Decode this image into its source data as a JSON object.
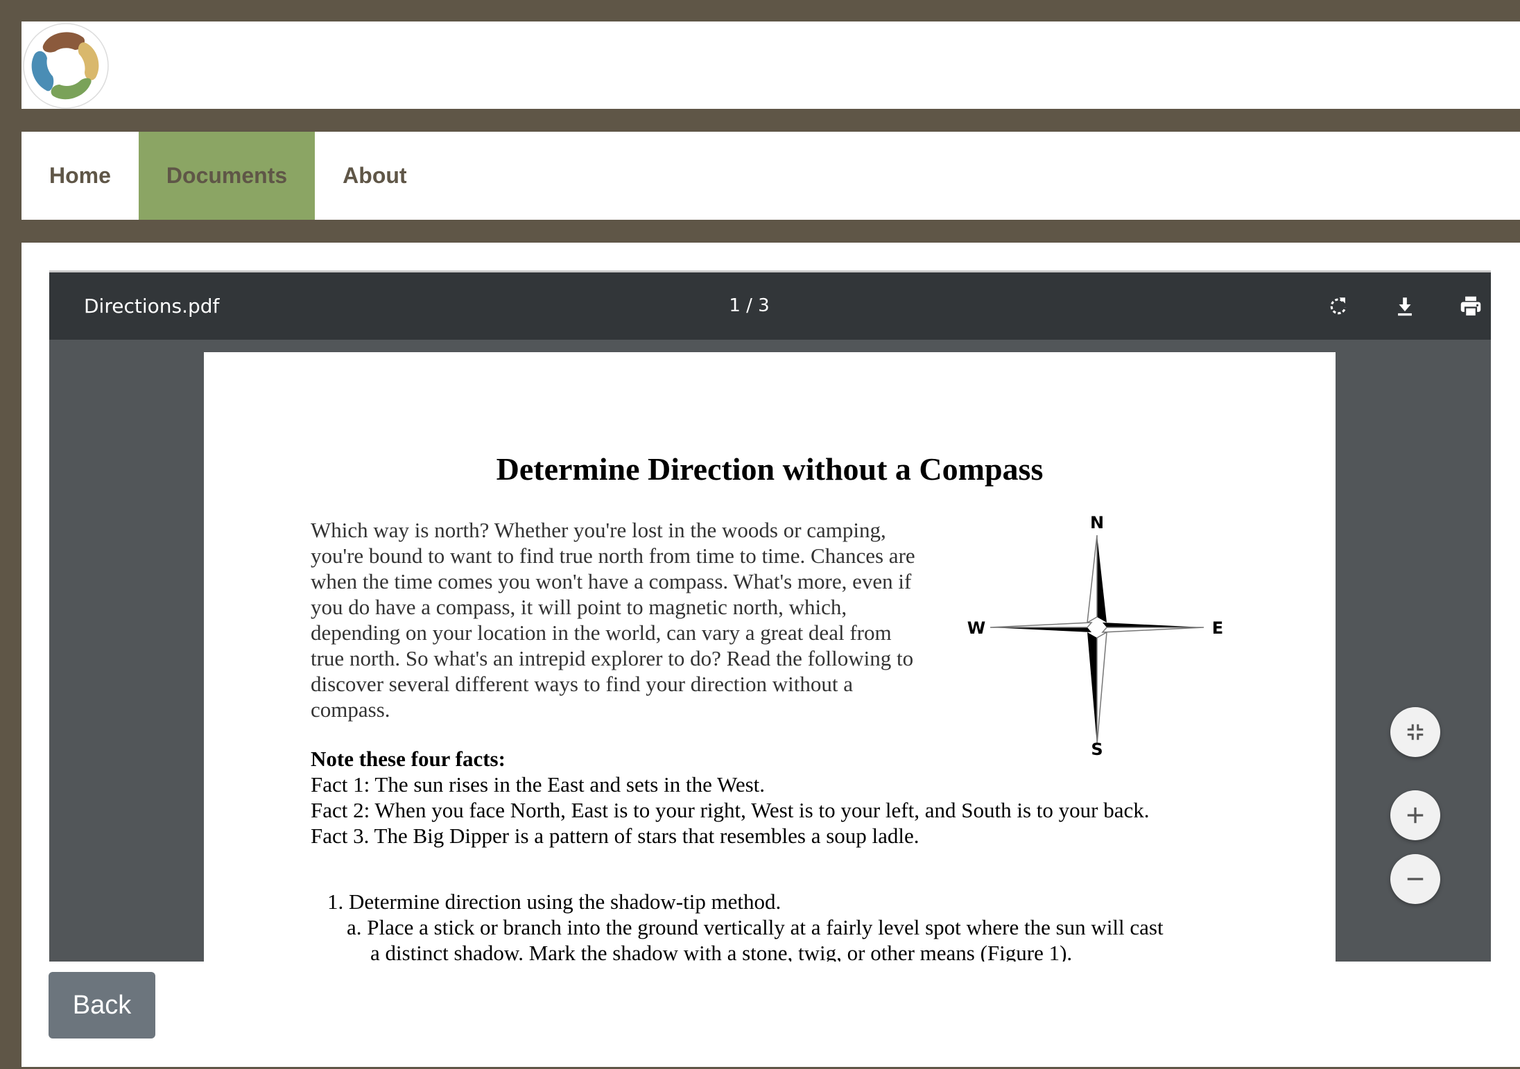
{
  "nav": {
    "items": [
      {
        "label": "Home",
        "active": false
      },
      {
        "label": "Documents",
        "active": true
      },
      {
        "label": "About",
        "active": false
      }
    ]
  },
  "viewer": {
    "filename": "Directions.pdf",
    "page_indicator": "1 / 3",
    "toolbar_icons": [
      "rotate-icon",
      "download-icon",
      "print-icon"
    ]
  },
  "document": {
    "title": "Determine Direction without a Compass",
    "intro_lines": [
      "Which way is north? Whether you're lost in the woods or camping,",
      "you're bound to want to find true north from time to time. Chances are",
      "when the time comes you won't have a compass. What's more, even if",
      "you do have a compass, it will point to magnetic north, which,",
      "depending on your location in the world, can vary a great deal from",
      "true north. So what's an intrepid explorer to do? Read the following to",
      "discover several different ways to find your direction without a",
      "compass."
    ],
    "facts_heading": "Note these four facts:",
    "facts": [
      "Fact 1: The sun rises in the East and sets in the West.",
      "Fact 2: When you face North, East is to your right, West is to your left, and South is to your back.",
      "Fact 3. The Big Dipper is a pattern of stars that resembles a soup ladle."
    ],
    "step1": "1.  Determine direction using the shadow-tip method.",
    "step1a": "a.  Place a stick or branch into the ground vertically at a fairly level spot where the sun will cast a distinct shadow. Mark the shadow with a stone, twig, or other means (Figure 1).",
    "compass": {
      "n": "N",
      "e": "E",
      "s": "S",
      "w": "W"
    }
  },
  "zoom_controls": [
    "fit-page-icon",
    "zoom-in-icon",
    "zoom-out-icon"
  ],
  "back_label": "Back",
  "colors": {
    "frame": "#5f5647",
    "nav_active": "#8ba564",
    "viewer_bg": "#525659",
    "toolbar_bg": "#323639",
    "back_button": "#6c757d"
  }
}
